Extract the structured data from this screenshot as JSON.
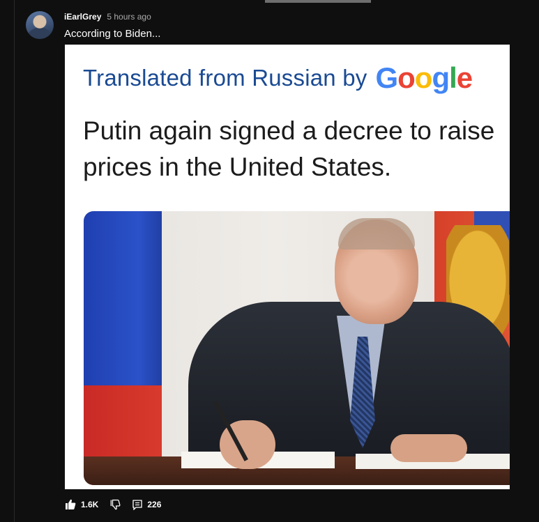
{
  "comment": {
    "author": "iEarlGrey",
    "time": "5 hours ago",
    "text": "According to Biden..."
  },
  "image_card": {
    "translated_label": "Translated from Russian by",
    "google_letters": [
      "G",
      "o",
      "o",
      "g",
      "l",
      "e"
    ],
    "headline": "Putin again signed a decree to raise\nprices in the United States."
  },
  "actions": {
    "likes": "1.6K",
    "replies": "226"
  },
  "icons": {
    "like": "thumbs-up-icon",
    "dislike": "thumbs-down-icon",
    "reply": "comment-icon"
  },
  "colors": {
    "background": "#0f0f0f",
    "text": "#ffffff",
    "muted": "#aaaaaa",
    "translated_text": "#1a4a93"
  }
}
